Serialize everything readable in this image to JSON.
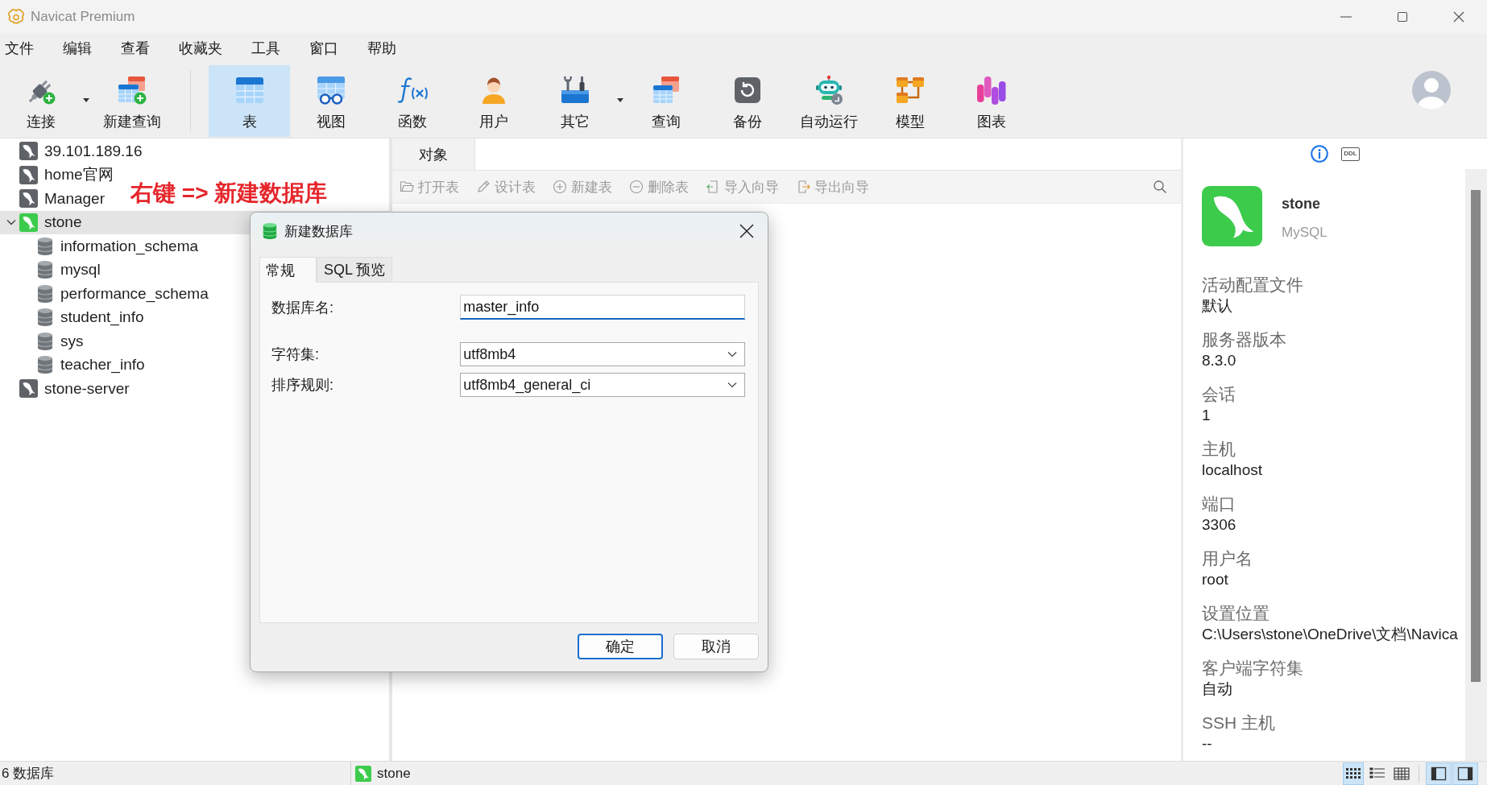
{
  "window": {
    "title": "Navicat Premium"
  },
  "menu": [
    "文件",
    "编辑",
    "查看",
    "收藏夹",
    "工具",
    "窗口",
    "帮助"
  ],
  "toolbar": {
    "groups": [
      [
        {
          "label": "连接",
          "selected": false,
          "dropdown": true
        },
        {
          "label": "新建查询",
          "selected": false,
          "dropdown": false
        }
      ],
      [
        {
          "label": "表",
          "selected": true,
          "dropdown": false
        },
        {
          "label": "视图",
          "selected": false,
          "dropdown": false
        },
        {
          "label": "函数",
          "selected": false,
          "dropdown": false
        },
        {
          "label": "用户",
          "selected": false,
          "dropdown": false
        },
        {
          "label": "其它",
          "selected": false,
          "dropdown": true
        },
        {
          "label": "查询",
          "selected": false,
          "dropdown": false
        },
        {
          "label": "备份",
          "selected": false,
          "dropdown": false
        },
        {
          "label": "自动运行",
          "selected": false,
          "dropdown": false
        },
        {
          "label": "模型",
          "selected": false,
          "dropdown": false
        },
        {
          "label": "图表",
          "selected": false,
          "dropdown": false
        }
      ]
    ]
  },
  "navigator": {
    "items": [
      {
        "kind": "connection",
        "name": "39.101.189.16",
        "connected": false,
        "expanded": false,
        "selected": false
      },
      {
        "kind": "connection",
        "name": "home官网",
        "connected": false,
        "expanded": false,
        "selected": false
      },
      {
        "kind": "connection",
        "name": "Manager",
        "connected": false,
        "expanded": false,
        "selected": false
      },
      {
        "kind": "connection",
        "name": "stone",
        "connected": true,
        "expanded": true,
        "selected": true,
        "children": [
          {
            "kind": "database",
            "name": "information_schema",
            "selected": false
          },
          {
            "kind": "database",
            "name": "mysql",
            "selected": false
          },
          {
            "kind": "database",
            "name": "performance_schema",
            "selected": false
          },
          {
            "kind": "database",
            "name": "student_info",
            "selected": false
          },
          {
            "kind": "database",
            "name": "sys",
            "selected": false
          },
          {
            "kind": "database",
            "name": "teacher_info",
            "selected": false
          }
        ]
      },
      {
        "kind": "connection",
        "name": "stone-server",
        "connected": false,
        "expanded": false,
        "selected": false
      }
    ]
  },
  "annotation": "右键 => 新建数据库",
  "objects": {
    "tabs": [
      {
        "label": "对象",
        "selected": true
      }
    ],
    "actions": [
      {
        "label": "打开表",
        "disabled": true
      },
      {
        "label": "设计表",
        "disabled": true
      },
      {
        "label": "新建表",
        "disabled": true
      },
      {
        "label": "删除表",
        "disabled": true
      },
      {
        "label": "导入向导",
        "disabled": true
      },
      {
        "label": "导出向导",
        "disabled": true
      }
    ]
  },
  "info_panel": {
    "tabs": [
      {
        "kind": "icon",
        "selected": true
      },
      {
        "kind": "text",
        "label": "DDL",
        "selected": false
      }
    ],
    "name": "stone",
    "type": "MySQL",
    "properties": [
      {
        "label": "活动配置文件",
        "value": "默认"
      },
      {
        "label": "服务器版本",
        "value": "8.3.0"
      },
      {
        "label": "会话",
        "value": "1"
      },
      {
        "label": "主机",
        "value": "localhost"
      },
      {
        "label": "端口",
        "value": "3306"
      },
      {
        "label": "用户名",
        "value": "root"
      },
      {
        "label": "设置位置",
        "value": "C:\\Users\\stone\\OneDrive\\文档\\Navica"
      },
      {
        "label": "客户端字符集",
        "value": "自动"
      },
      {
        "label": "SSH 主机",
        "value": "--"
      }
    ]
  },
  "dialog": {
    "title": "新建数据库",
    "tabs": [
      {
        "label": "常规",
        "selected": true
      },
      {
        "label": "SQL 预览",
        "selected": false
      }
    ],
    "fields": [
      {
        "kind": "text",
        "label": "数据库名:",
        "value": "master_info",
        "focused": true
      },
      {
        "kind": "select",
        "label": "字符集:",
        "value": "utf8mb4"
      },
      {
        "kind": "select",
        "label": "排序规则:",
        "value": "utf8mb4_general_ci"
      }
    ],
    "buttons": [
      {
        "label": "确定",
        "default": true
      },
      {
        "label": "取消",
        "default": false
      }
    ]
  },
  "status_bar": {
    "count": "6 数据库",
    "connection": {
      "name": "stone",
      "connected": true
    },
    "view_modes": [
      {
        "selected": true
      },
      {
        "selected": false
      },
      {
        "selected": false
      }
    ],
    "panes": [
      {
        "selected": true
      },
      {
        "selected": true
      }
    ]
  }
}
